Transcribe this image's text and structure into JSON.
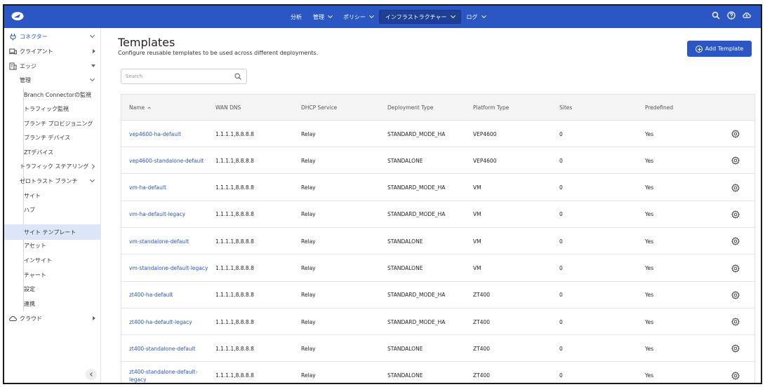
{
  "nav": {
    "items": [
      {
        "label": "分析",
        "dropdown": false
      },
      {
        "label": "管理",
        "dropdown": true
      },
      {
        "label": "ポリシー",
        "dropdown": true
      },
      {
        "label": "インフラストラクチャー",
        "dropdown": true
      },
      {
        "label": "ログ",
        "dropdown": true
      }
    ],
    "active_index": 3,
    "right_icons": [
      "search-icon",
      "help-icon",
      "cloud-icon"
    ],
    "colors": {
      "bar": "#2a57c4",
      "active": "#1d3f96"
    }
  },
  "sidebar": {
    "items": [
      {
        "label": "コネクター",
        "icon": "plug-icon"
      },
      {
        "label": "クライアント",
        "icon": "devices-icon"
      },
      {
        "label": "エッジ",
        "icon": "building-icon"
      },
      {
        "label": "管理"
      },
      {
        "label": "Branch Connectorの監視"
      },
      {
        "label": "トラフィック監視"
      },
      {
        "label": "ブランチ プロビジョニング"
      },
      {
        "label": "ブランチ デバイス"
      },
      {
        "label": "ZTデバイス"
      },
      {
        "label": "トラフィック ステアリング"
      },
      {
        "label": "ゼロトラスト ブランチ"
      },
      {
        "label": "サイト"
      },
      {
        "label": "ハブ"
      },
      {
        "label": "サイト テンプレート",
        "selected": true
      },
      {
        "label": "アセット"
      },
      {
        "label": "インサイト"
      },
      {
        "label": "チャート"
      },
      {
        "label": "設定"
      },
      {
        "label": "連携"
      },
      {
        "label": "クラウド",
        "icon": "cloud-icon"
      }
    ]
  },
  "page": {
    "title": "Templates",
    "subtitle": "Configure reusable templates to be used across different deployments.",
    "add_button": "Add Template"
  },
  "search": {
    "placeholder": "Search",
    "value": ""
  },
  "table": {
    "columns": [
      "Name",
      "WAN DNS",
      "DHCP Service",
      "Deployment Type",
      "Platform Type",
      "Sites",
      "Predefined"
    ],
    "sort_column": "Name",
    "rows": [
      {
        "name": "vep4600-ha-default",
        "wan_dns": "1.1.1.1,8.8.8.8",
        "dhcp": "Relay",
        "deployment": "STANDARD_MODE_HA",
        "platform": "VEP4600",
        "sites": "0",
        "predefined": "Yes"
      },
      {
        "name": "vep4600-standalone-default",
        "wan_dns": "1.1.1.1,8.8.8.8",
        "dhcp": "Relay",
        "deployment": "STANDALONE",
        "platform": "VEP4600",
        "sites": "0",
        "predefined": "Yes"
      },
      {
        "name": "vm-ha-default",
        "wan_dns": "1.1.1.1,8.8.8.8",
        "dhcp": "Relay",
        "deployment": "STANDARD_MODE_HA",
        "platform": "VM",
        "sites": "0",
        "predefined": "Yes"
      },
      {
        "name": "vm-ha-default-legacy",
        "wan_dns": "1.1.1.1,8.8.8.8",
        "dhcp": "Relay",
        "deployment": "STANDARD_MODE_HA",
        "platform": "VM",
        "sites": "0",
        "predefined": "Yes"
      },
      {
        "name": "vm-standalone-default",
        "wan_dns": "1.1.1.1,8.8.8.8",
        "dhcp": "Relay",
        "deployment": "STANDALONE",
        "platform": "VM",
        "sites": "0",
        "predefined": "Yes"
      },
      {
        "name": "vm-standalone-default-legacy",
        "wan_dns": "1.1.1.1,8.8.8.8",
        "dhcp": "Relay",
        "deployment": "STANDALONE",
        "platform": "VM",
        "sites": "0",
        "predefined": "Yes"
      },
      {
        "name": "zt400-ha-default",
        "wan_dns": "1.1.1.1,8.8.8.8",
        "dhcp": "Relay",
        "deployment": "STANDARD_MODE_HA",
        "platform": "ZT400",
        "sites": "0",
        "predefined": "Yes"
      },
      {
        "name": "zt400-ha-default-legacy",
        "wan_dns": "1.1.1.1,8.8.8.8",
        "dhcp": "Relay",
        "deployment": "STANDARD_MODE_HA",
        "platform": "ZT400",
        "sites": "0",
        "predefined": "Yes"
      },
      {
        "name": "zt400-standalone-default",
        "wan_dns": "1.1.1.1,8.8.8.8",
        "dhcp": "Relay",
        "deployment": "STANDALONE",
        "platform": "ZT400",
        "sites": "0",
        "predefined": "Yes"
      },
      {
        "name": "zt400-standalone-default-legacy",
        "wan_dns": "1.1.1.1,8.8.8.8",
        "dhcp": "Relay",
        "deployment": "STANDALONE",
        "platform": "ZT400",
        "sites": "0",
        "predefined": "Yes"
      }
    ]
  }
}
